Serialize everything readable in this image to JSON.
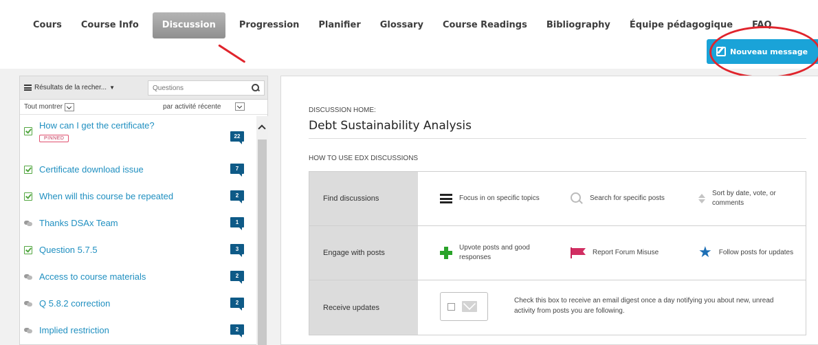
{
  "nav": {
    "tabs": [
      {
        "label": "Cours"
      },
      {
        "label": "Course Info"
      },
      {
        "label": "Discussion",
        "active": true
      },
      {
        "label": "Progression"
      },
      {
        "label": "Planifier"
      },
      {
        "label": "Glossary"
      },
      {
        "label": "Course Readings"
      },
      {
        "label": "Bibliography"
      },
      {
        "label": "Équipe pédagogique"
      },
      {
        "label": "FAQ"
      }
    ],
    "new_message_label": "Nouveau message"
  },
  "sidebar": {
    "filter_label": "Résultats de la recher...",
    "filter_caret": "▼",
    "search_placeholder": "Questions",
    "show_all_label": "Tout montrer",
    "sort_label": "par activité récente",
    "threads": [
      {
        "title": "How can I get the certificate?",
        "count": "22",
        "status": "answered",
        "pinned_label": "PINNED"
      },
      {
        "title": "Certificate download issue",
        "count": "7",
        "status": "answered"
      },
      {
        "title": "When will this course be repeated",
        "count": "2",
        "status": "answered"
      },
      {
        "title": "Thanks DSAx Team",
        "count": "1",
        "status": "discussion"
      },
      {
        "title": "Question 5.7.5",
        "count": "3",
        "status": "answered"
      },
      {
        "title": "Access to course materials",
        "count": "2",
        "status": "discussion"
      },
      {
        "title": "Q 5.8.2 correction",
        "count": "2",
        "status": "discussion"
      },
      {
        "title": "Implied restriction",
        "count": "2",
        "status": "discussion"
      }
    ]
  },
  "main": {
    "home_label": "DISCUSSION HOME:",
    "course_title": "Debt Sustainability Analysis",
    "howto_label": "HOW TO USE EDX DISCUSSIONS",
    "rows": [
      {
        "category": "Find discussions",
        "items": [
          {
            "icon": "list-icon",
            "text": "Focus in on specific topics"
          },
          {
            "icon": "magnifier-icon",
            "text": "Search for specific posts"
          },
          {
            "icon": "sort-icon",
            "text": "Sort by date, vote, or comments"
          }
        ]
      },
      {
        "category": "Engage with posts",
        "items": [
          {
            "icon": "plus-icon",
            "text": "Upvote posts and good responses"
          },
          {
            "icon": "flag-icon",
            "text": "Report Forum Misuse"
          },
          {
            "icon": "star-icon",
            "text": "Follow posts for updates"
          }
        ]
      },
      {
        "category": "Receive updates",
        "digest_text": "Check this box to receive an email digest once a day notifying you about new, unread activity from posts you are following."
      }
    ]
  },
  "colors": {
    "accent_blue": "#1aa3d8",
    "count_badge": "#0e5a87",
    "link": "#1f8fc0",
    "annotation_red": "#e0242c",
    "answered_green": "#52a640"
  }
}
